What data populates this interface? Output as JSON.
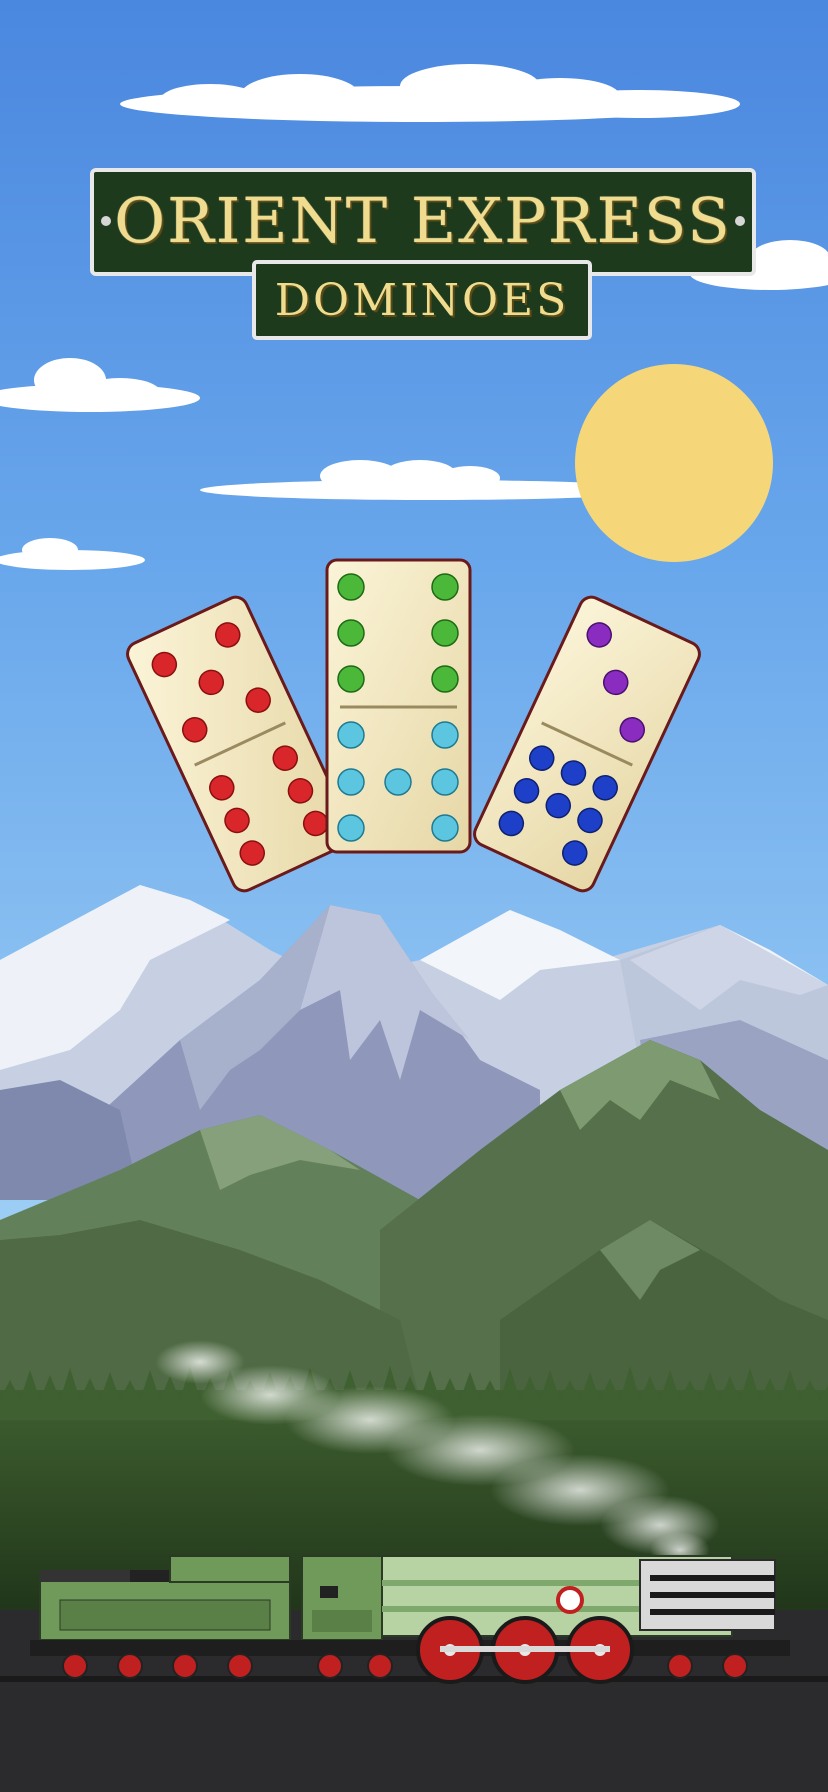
{
  "game": {
    "title_line1": "ORIENT EXPRESS",
    "title_line2": "DOMINOES"
  },
  "dominoes": [
    {
      "name": "left",
      "top_pips": 5,
      "bottom_pips": 6,
      "top_color": "#d8262a",
      "bottom_color": "#d8262a"
    },
    {
      "name": "center",
      "top_pips": 6,
      "bottom_pips": 7,
      "top_color": "#4cb83a",
      "bottom_color": "#5cc6e0"
    },
    {
      "name": "right",
      "top_pips": 3,
      "bottom_pips": 8,
      "top_color": "#8a2cc0",
      "bottom_color": "#1e3fc8"
    }
  ],
  "colors": {
    "sky_top": "#4a8be0",
    "sky_bottom": "#8ec8f4",
    "sign_green": "#1e3a1c",
    "sign_gold": "#f0dc8e",
    "sun": "#f5d77a",
    "mountain_far": "#c9d2e3",
    "mountain_mid": "#8f98bb",
    "hill_green": "#55704a",
    "forest": "#2d4a22",
    "train_green": "#6f9a5a",
    "wheel_red": "#c02020"
  }
}
